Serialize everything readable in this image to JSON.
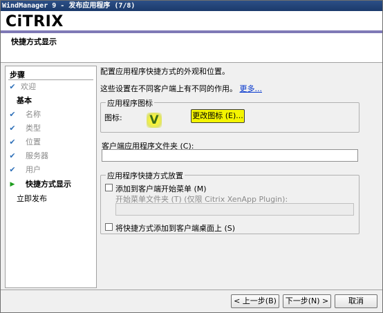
{
  "window": {
    "title": "WindManager 9 - 发布应用程序 (7/8)"
  },
  "header": {
    "logo": "CiTRIX",
    "page_title": "快捷方式显示"
  },
  "sidebar": {
    "title": "步骤",
    "steps": [
      {
        "label": "欢迎"
      },
      {
        "label": "基本"
      },
      {
        "label": "名称"
      },
      {
        "label": "类型"
      },
      {
        "label": "位置"
      },
      {
        "label": "服务器"
      },
      {
        "label": "用户"
      },
      {
        "label": "快捷方式显示"
      },
      {
        "label": "立即发布"
      }
    ]
  },
  "main": {
    "intro": "配置应用程序快捷方式的外观和位置。",
    "note": "这些设置在不同客户端上有不同的作用。",
    "more_link": "更多...",
    "icon_group": {
      "title": "应用程序图标",
      "icon_label": "图标:",
      "change_button": "更改图标 (E)..."
    },
    "folder": {
      "label": "客户端应用程序文件夹 (C):",
      "value": ""
    },
    "placement_group": {
      "title": "应用程序快捷方式放置",
      "start_menu_label": "添加到客户端开始菜单 (M)",
      "start_menu_checked": false,
      "start_folder_label": "开始菜单文件夹 (T) (仅限 Citrix XenApp Plugin):",
      "start_folder_value": "",
      "desktop_label": "将快捷方式添加到客户端桌面上 (S)",
      "desktop_checked": false
    }
  },
  "footer": {
    "back": "< 上一步(B)",
    "next": "下一步(N) >",
    "cancel": "取消"
  }
}
